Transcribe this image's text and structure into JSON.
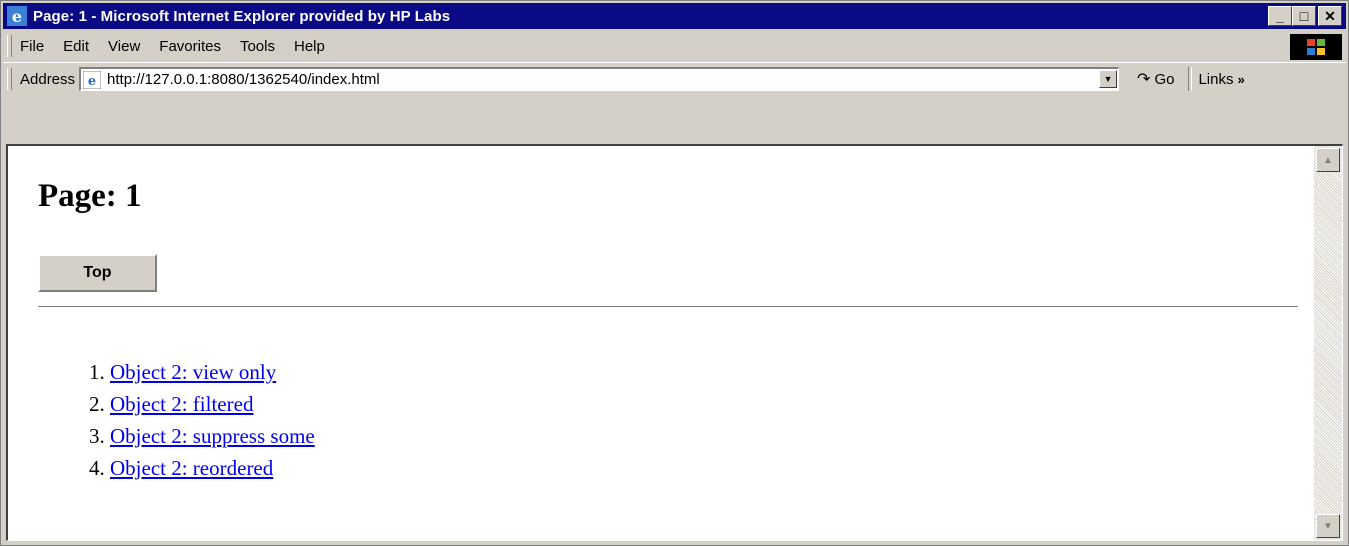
{
  "window": {
    "title": "Page: 1 - Microsoft Internet Explorer provided by HP Labs",
    "min_label": "_",
    "max_label": "□",
    "close_label": "✕"
  },
  "menu": {
    "items": [
      "File",
      "Edit",
      "View",
      "Favorites",
      "Tools",
      "Help"
    ]
  },
  "address": {
    "label": "Address",
    "url": "http://127.0.0.1:8080/1362540/index.html",
    "go_label": "Go",
    "links_label": "Links"
  },
  "page": {
    "heading": "Page: 1",
    "top_button": "Top",
    "list": [
      "Object 2: view only",
      "Object 2: filtered",
      "Object 2: suppress some",
      "Object 2: reordered"
    ]
  },
  "colors": {
    "titlebar": "#0a0a84",
    "link": "#0000ee",
    "chrome": "#d4d0c8"
  }
}
